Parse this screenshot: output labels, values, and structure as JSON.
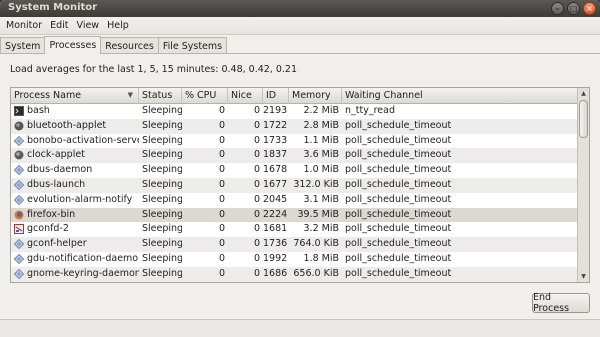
{
  "window": {
    "title": "System Monitor"
  },
  "menubar": [
    "Monitor",
    "Edit",
    "View",
    "Help"
  ],
  "tabs": [
    "System",
    "Processes",
    "Resources",
    "File Systems"
  ],
  "load_averages": "Load averages for the last 1, 5, 15 minutes: 0.48, 0.42, 0.21",
  "table": {
    "columns": [
      "Process Name",
      "Status",
      "% CPU",
      "Nice",
      "ID",
      "Memory",
      "Waiting Channel"
    ],
    "rows": [
      {
        "name": "bash",
        "status": "Sleeping",
        "cpu": "0",
        "nice": "0",
        "id": "2193",
        "memory": "2.2 MiB",
        "channel": "n_tty_read",
        "icon": "terminal-icon"
      },
      {
        "name": "bluetooth-applet",
        "status": "Sleeping",
        "cpu": "0",
        "nice": "0",
        "id": "1722",
        "memory": "2.8 MiB",
        "channel": "poll_schedule_timeout",
        "icon": "bluetooth-icon"
      },
      {
        "name": "bonobo-activation-server",
        "status": "Sleeping",
        "cpu": "0",
        "nice": "0",
        "id": "1733",
        "memory": "1.1 MiB",
        "channel": "poll_schedule_timeout",
        "icon": "process-icon"
      },
      {
        "name": "clock-applet",
        "status": "Sleeping",
        "cpu": "0",
        "nice": "0",
        "id": "1837",
        "memory": "3.6 MiB",
        "channel": "poll_schedule_timeout",
        "icon": "clock-icon"
      },
      {
        "name": "dbus-daemon",
        "status": "Sleeping",
        "cpu": "0",
        "nice": "0",
        "id": "1678",
        "memory": "1.0 MiB",
        "channel": "poll_schedule_timeout",
        "icon": "process-icon"
      },
      {
        "name": "dbus-launch",
        "status": "Sleeping",
        "cpu": "0",
        "nice": "0",
        "id": "1677",
        "memory": "312.0 KiB",
        "channel": "poll_schedule_timeout",
        "icon": "process-icon"
      },
      {
        "name": "evolution-alarm-notify",
        "status": "Sleeping",
        "cpu": "0",
        "nice": "0",
        "id": "2045",
        "memory": "3.1 MiB",
        "channel": "poll_schedule_timeout",
        "icon": "process-icon"
      },
      {
        "name": "firefox-bin",
        "status": "Sleeping",
        "cpu": "0",
        "nice": "0",
        "id": "2224",
        "memory": "39.5 MiB",
        "channel": "poll_schedule_timeout",
        "icon": "firefox-icon"
      },
      {
        "name": "gconfd-2",
        "status": "Sleeping",
        "cpu": "0",
        "nice": "0",
        "id": "1681",
        "memory": "3.2 MiB",
        "channel": "poll_schedule_timeout",
        "icon": "gconf-icon"
      },
      {
        "name": "gconf-helper",
        "status": "Sleeping",
        "cpu": "0",
        "nice": "0",
        "id": "1736",
        "memory": "764.0 KiB",
        "channel": "poll_schedule_timeout",
        "icon": "process-icon"
      },
      {
        "name": "gdu-notification-daemon",
        "status": "Sleeping",
        "cpu": "0",
        "nice": "0",
        "id": "1992",
        "memory": "1.8 MiB",
        "channel": "poll_schedule_timeout",
        "icon": "process-icon"
      },
      {
        "name": "gnome-keyring-daemon",
        "status": "Sleeping",
        "cpu": "0",
        "nice": "0",
        "id": "1686",
        "memory": "656.0 KiB",
        "channel": "poll_schedule_timeout",
        "icon": "process-icon"
      }
    ]
  },
  "buttons": {
    "end_process": "End Process"
  },
  "colors": {
    "titlebar": "#3c3b37",
    "window_bg": "#f0efec",
    "selected_row": "#dcd9d2",
    "close_button": "#e05b2a"
  }
}
